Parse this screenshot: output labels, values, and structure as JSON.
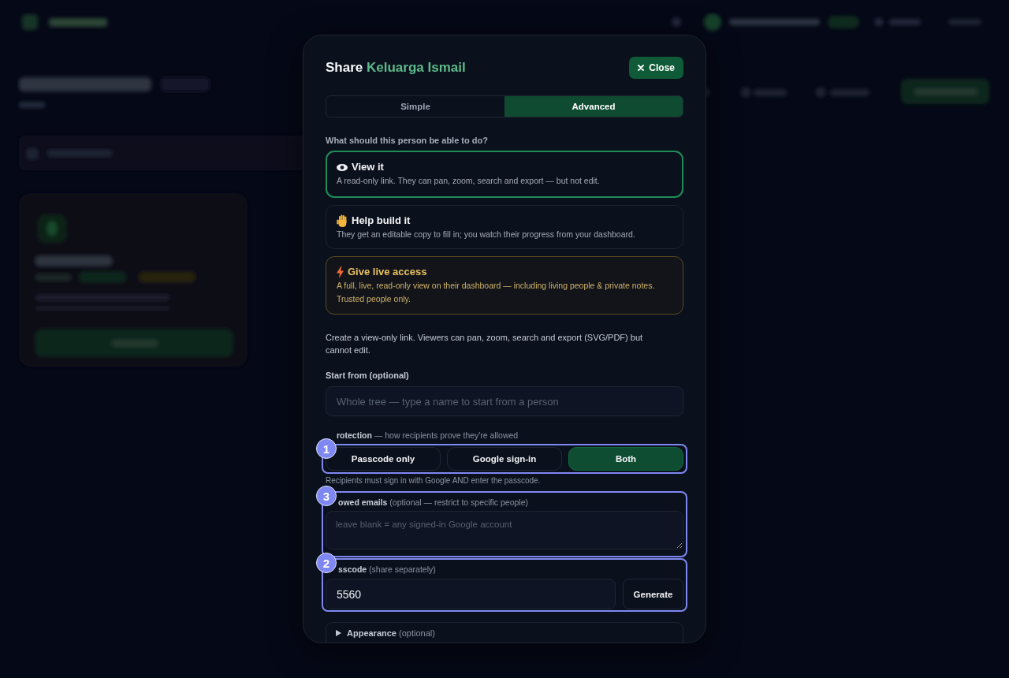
{
  "dialog": {
    "title": "Share",
    "title_highlight": "Keluarga Ismail",
    "close_button": "Close",
    "tabs": [
      {
        "label": "Simple",
        "selected": false
      },
      {
        "label": "Advanced",
        "selected": true
      }
    ],
    "question": "What should this person be able to do?",
    "options": [
      {
        "kind": "view",
        "title": "View it",
        "description": "A read-only link. They can pan, zoom, search and export — but not edit.",
        "selected": true
      },
      {
        "kind": "edit",
        "title": "Help build it",
        "description": "They get an editable copy to fill in; you watch their progress from your dashboard.",
        "selected": false
      },
      {
        "kind": "live",
        "title": "Give live access",
        "description": "A full, live, read-only view on their dashboard — including living people & private notes. Trusted people only.",
        "selected": false
      }
    ],
    "mode_description": "Create a view-only link. Viewers can pan, zoom, search and export (SVG/PDF) but cannot edit.",
    "start_from": {
      "label": "Start from (optional)",
      "placeholder": "Whole tree — type a name to start from a person"
    },
    "protection": {
      "label": "**rotection** — how recipients prove they're allowed",
      "marker": "1",
      "options": [
        {
          "label": "Passcode only",
          "selected": false
        },
        {
          "label": "Google sign-in",
          "selected": false
        },
        {
          "label": "Both",
          "selected": true
        }
      ],
      "note": "Recipients must sign in with Google AND enter the passcode."
    },
    "allowed_emails": {
      "label": "**owed emails** (optional — restrict to specific people)",
      "marker": "3",
      "placeholder": "leave blank = any signed-in Google account"
    },
    "passcode": {
      "label": "**sscode** (share separately)",
      "marker": "2",
      "value": "5560",
      "button": "Generate"
    },
    "appearance": {
      "label": "**Appearance** (optional)",
      "expanded": false
    }
  }
}
